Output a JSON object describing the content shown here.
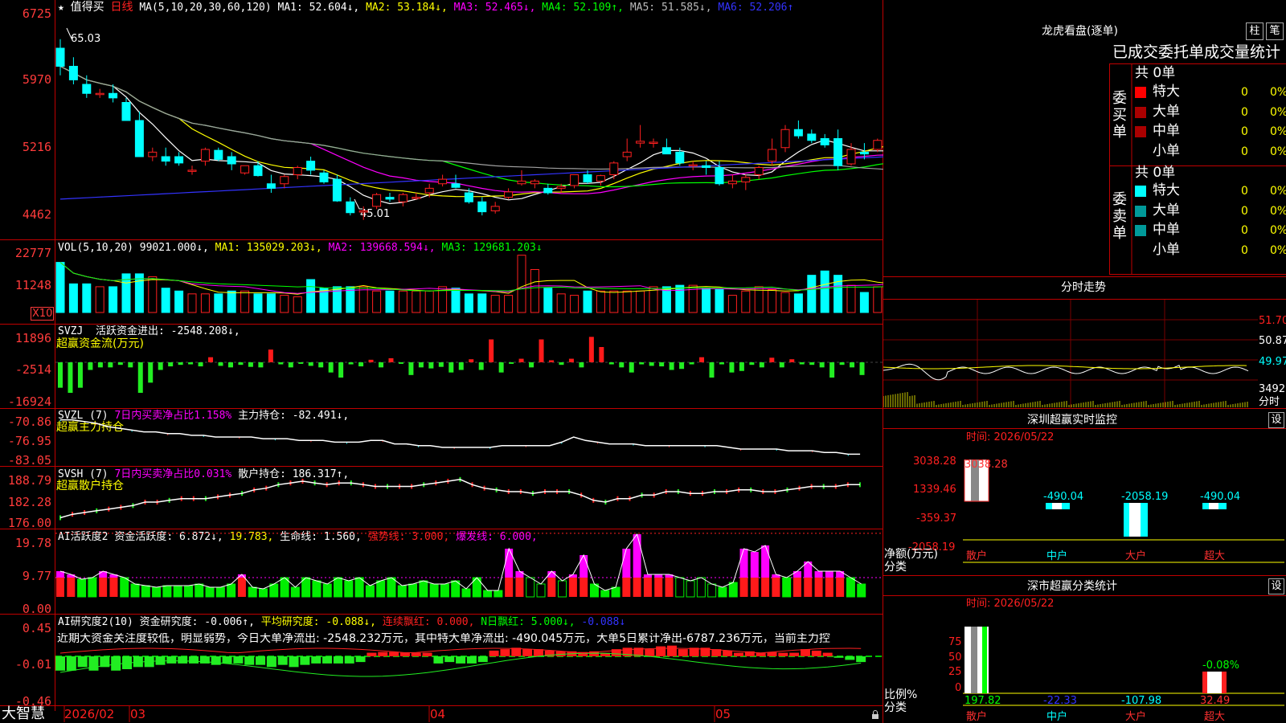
{
  "colors": {
    "up": "#ff2020",
    "down": "#00ffff",
    "ma1": "#ffffff",
    "ma2": "#ffff00",
    "ma3": "#ff00ff",
    "ma4": "#00ff00",
    "ma5": "#a0a0a0",
    "ma6": "#3333ff"
  },
  "kline": {
    "star": "★",
    "stock_name": "值得买",
    "period": "日线",
    "ma_title": "MA(5,10,20,30,60,120)",
    "ma1": "MA1: 52.604↓,",
    "ma2": "MA2: 53.184↓,",
    "ma3": "MA3: 52.465↓,",
    "ma4": "MA4: 52.109↑,",
    "ma5": "MA5: 51.585↓,",
    "ma6": "MA6: 52.206↑",
    "high_mark": "65.03",
    "low_mark": "45.01",
    "y_labels": [
      "6725",
      "5970",
      "5216",
      "4462"
    ]
  },
  "vol": {
    "title": "VOL(5,10,20)",
    "val": "99021.000↓,",
    "ma1": "MA1: 135029.203↓,",
    "ma2": "MA2: 139668.594↓,",
    "ma3": "MA3: 129681.203↓",
    "y_labels": [
      "22777",
      "11248"
    ],
    "unit": "X10"
  },
  "svzj": {
    "title": "SVZJ",
    "desc": "活跃资金进出: -2548.208↓,",
    "sub": "超赢资金流(万元)",
    "y_labels": [
      "11896",
      "-2514",
      "-16924"
    ]
  },
  "svzl": {
    "title": "SVZL (7)",
    "desc": "7日内买卖净占比1.158%",
    "desc2": "主力持仓: -82.491↓,",
    "sub": "超赢主力持仓",
    "y_labels": [
      "-70.86",
      "-76.95",
      "-83.05"
    ]
  },
  "svsh": {
    "title": "SVSH (7)",
    "desc": "7日内买卖净占比0.031%",
    "desc2": "散户持仓: 186.317↑,",
    "sub": "超赢散户持仓",
    "y_labels": [
      "188.79",
      "182.28",
      "176.00"
    ]
  },
  "ai1": {
    "title": "AI活跃度2",
    "l1": "资金活跃度: 6.872↓,",
    "l2": "19.783,",
    "l3": "生命线: 1.560,",
    "l4": "强势线: 3.000,",
    "l5": "爆发线: 6.000,",
    "y_labels": [
      "19.78",
      "9.77",
      "0.00"
    ]
  },
  "ai2": {
    "title": "AI研究度2(10)",
    "l1": "资金研究度: -0.006↑,",
    "l2": "平均研究度: -0.088↓,",
    "l3": "连续飘红: 0.000,",
    "l4": "N日飘红: 5.000↓,",
    "l5": "-0.088↓",
    "comment": "近期大资金关注度较低，明显弱势，今日大单净流出: -2548.232万元，其中特大单净流出: -490.045万元，大单5日累计净出-6787.236万元，当前主力控",
    "y_labels": [
      "0.45",
      "-0.01",
      "-0.46"
    ]
  },
  "xaxis": {
    "brand": "大智慧",
    "labels": [
      "2026/02",
      "03",
      "04",
      "05"
    ]
  },
  "lhb": {
    "title": "龙虎看盘(逐单)",
    "btn1": "柱",
    "btn2": "笔",
    "header": "已成交委托单成交量统计",
    "buy_side": "委买单",
    "sell_side": "委卖单",
    "buy_total": "共 0单",
    "sell_total": "共 0单",
    "rows": [
      "特大",
      "大单",
      "中单",
      "小单"
    ],
    "vals": [
      "0",
      "0",
      "0",
      "0"
    ],
    "pcts": [
      "0%",
      "0%",
      "0%",
      "0%"
    ]
  },
  "fenshi": {
    "title": "分时走势",
    "right_labels": [
      "51.70",
      "50.87",
      "49.97",
      "3492",
      "分时"
    ]
  },
  "shenzhen": {
    "title": "深圳超赢实时监控",
    "btn": "设",
    "time": "时间: 2026/05/22",
    "y_labels": [
      "3038.28",
      "1339.46",
      "-359.37",
      "-2058.19"
    ],
    "axis_label": "净额(万元)",
    "axis_label2": "分类",
    "categories": [
      "散户",
      "中户",
      "大户",
      "超大"
    ],
    "values": [
      "3038.28",
      "-490.04",
      "-2058.19",
      "-490.04"
    ]
  },
  "shishi": {
    "title": "深市超赢分类统计",
    "btn": "设",
    "time": "时间: 2026/05/22",
    "y_labels": [
      "75",
      "50",
      "25",
      "0"
    ],
    "axis_label": "比例%",
    "axis_label2": "分类",
    "categories": [
      "散户",
      "中户",
      "大户",
      "超大"
    ],
    "values": [
      "197.82",
      "-22.33",
      "-107.98",
      "32.49"
    ],
    "annot": "-0.08%"
  },
  "chart_data": [
    {
      "type": "candlestick",
      "title": "值得买 日线",
      "ylim": [
        44,
        68
      ],
      "ohlc": [
        [
          64,
          65,
          61,
          62
        ],
        [
          62,
          63,
          60,
          60.5
        ],
        [
          60,
          61,
          58.5,
          59
        ],
        [
          59,
          59.5,
          58.5,
          59
        ],
        [
          59,
          60,
          58,
          58.5
        ],
        [
          58,
          58.5,
          56,
          56
        ],
        [
          56,
          57,
          52,
          52
        ],
        [
          52,
          53,
          51.5,
          52.5
        ],
        [
          52,
          53,
          51,
          51.5
        ],
        [
          52,
          52.5,
          51,
          51.3
        ],
        [
          50.5,
          51,
          50,
          50.5
        ],
        [
          51.5,
          53,
          51,
          52.8
        ],
        [
          52.7,
          53,
          51.5,
          51.7
        ],
        [
          52,
          52.5,
          50.5,
          51.2
        ],
        [
          50.2,
          51,
          50,
          51
        ],
        [
          51,
          51.5,
          49.8,
          49.9
        ],
        [
          49,
          50,
          48,
          48.5
        ],
        [
          49,
          50,
          48.5,
          49.8
        ],
        [
          50,
          51,
          49.5,
          50.8
        ],
        [
          51.5,
          52,
          50,
          50.5
        ],
        [
          50.2,
          50.5,
          49,
          49.2
        ],
        [
          49.5,
          50,
          47,
          47.1
        ],
        [
          47,
          47.5,
          45.5,
          45.8
        ],
        [
          46,
          46.5,
          45,
          46
        ],
        [
          46.5,
          48,
          46.2,
          47.8
        ],
        [
          47.5,
          48,
          47,
          47.3
        ],
        [
          47,
          48,
          46.5,
          47.8
        ],
        [
          47.5,
          48,
          47.2,
          47.5
        ],
        [
          48,
          49,
          47.5,
          48.5
        ],
        [
          49,
          50,
          48.7,
          49.5
        ],
        [
          49,
          50,
          48.5,
          48.6
        ],
        [
          48,
          48.5,
          46.8,
          47
        ],
        [
          47,
          47.5,
          45.5,
          45.9
        ],
        [
          46,
          47,
          45.7,
          46.5
        ],
        [
          47.5,
          48.5,
          47.3,
          48.1
        ],
        [
          49,
          50.5,
          48.8,
          49.3
        ],
        [
          49,
          49.5,
          48.5,
          49.3
        ],
        [
          48.5,
          49,
          47.8,
          48
        ],
        [
          48.5,
          49,
          48,
          48.7
        ],
        [
          48.8,
          50,
          48.5,
          50
        ],
        [
          50,
          50.5,
          49,
          49.2
        ],
        [
          49.3,
          50,
          48.8,
          49.9
        ],
        [
          50,
          51.5,
          49.5,
          51.3
        ],
        [
          52,
          54,
          51.5,
          52.5
        ],
        [
          53.5,
          55.5,
          53,
          53.7
        ],
        [
          53.5,
          54,
          53,
          53.6
        ],
        [
          53,
          54,
          52.5,
          52.3
        ],
        [
          52.5,
          53,
          51,
          51.3
        ],
        [
          51,
          51.5,
          50.5,
          51.1
        ],
        [
          51,
          51.5,
          50,
          50.8
        ],
        [
          50.8,
          51.5,
          48.8,
          49
        ],
        [
          49,
          50,
          48.5,
          49.3
        ],
        [
          49.2,
          50,
          48.3,
          49.7
        ],
        [
          50,
          51,
          49.5,
          50.8
        ],
        [
          51.5,
          54,
          51,
          52.8
        ],
        [
          53,
          55.5,
          52.5,
          55
        ],
        [
          55,
          56,
          54,
          54.3
        ],
        [
          54.5,
          55,
          53.5,
          53.8
        ],
        [
          54,
          54.5,
          53,
          53.3
        ],
        [
          54,
          55,
          50.5,
          51
        ],
        [
          51.2,
          53.5,
          51,
          52.8
        ],
        [
          52.5,
          53.5,
          51.7,
          52.3
        ],
        [
          52.8,
          54,
          52.5,
          53.8
        ],
        [
          54.5,
          55.5,
          53,
          53.3
        ],
        [
          53.5,
          55,
          52.5,
          52.8
        ],
        [
          53,
          54,
          51.5,
          51.7
        ],
        [
          51.5,
          52,
          50.5,
          50.7
        ]
      ]
    },
    {
      "type": "bar",
      "title": "VOL(5,10,20)",
      "values": [
        17500,
        10000,
        10000,
        9000,
        9000,
        13500,
        13500,
        12500,
        8500,
        7500,
        6500,
        6500,
        6500,
        7500,
        7500,
        6500,
        6500,
        6000,
        5500,
        11500,
        8500,
        9000,
        9000,
        9000,
        7500,
        7500,
        7500,
        7500,
        7500,
        9000,
        8500,
        6500,
        6500,
        6000,
        6000,
        20000,
        15000,
        8500,
        6500,
        6000,
        7500,
        7500,
        7500,
        7500,
        7500,
        9000,
        9000,
        9500,
        9500,
        8500,
        8000,
        6000,
        7500,
        9000,
        8000,
        7000,
        6500,
        13000,
        14500,
        13000,
        9500,
        7000,
        9000,
        12000,
        11000,
        11000,
        13000,
        11500,
        11000,
        8000
      ]
    },
    {
      "type": "bar",
      "title": "SVZJ",
      "values": [
        -5000,
        -6000,
        -5000,
        -1500,
        -1000,
        -1000,
        -500,
        -1000,
        -6000,
        -4000,
        -1500,
        -800,
        -500,
        -400,
        -800,
        1000,
        -700,
        -1000,
        -500,
        -900,
        -1000,
        2500,
        -400,
        -1000,
        -300,
        -700,
        -1000,
        -2000,
        -3000,
        -400,
        -800,
        500,
        -1000,
        800,
        -300,
        -2500,
        -1000,
        -1200,
        -900,
        -2000,
        -1500,
        600,
        -1500,
        4500,
        -2000,
        -300,
        700,
        -1000,
        4500,
        400,
        -500,
        700,
        -1000,
        5000,
        3000,
        -400,
        -1000,
        -2000,
        -400,
        -700,
        -800,
        -1500,
        -1300,
        -400,
        1000,
        -3000,
        -400,
        -2000,
        -1700,
        -500,
        -1000,
        900,
        -1000,
        600,
        -400,
        -500,
        -1000,
        -3000,
        -500,
        -1000,
        -2500
      ]
    },
    {
      "type": "line",
      "title": "SVZL",
      "values": [
        -72,
        -72,
        -72.5,
        -73,
        -74,
        -74.5,
        -75,
        -75.5,
        -75.5,
        -76,
        -76,
        -76.5,
        -76.5,
        -77,
        -77,
        -77,
        -77,
        -77.5,
        -77.5,
        -77.5,
        -78,
        -78,
        -78,
        -78.5,
        -78.5,
        -78.5,
        -78,
        -78,
        -79,
        -79,
        -79.5,
        -79.5,
        -80,
        -80,
        -80,
        -80,
        -80,
        -79.5,
        -79.5,
        -79.5,
        -79.5,
        -79.5,
        -78.5,
        -77,
        -78,
        -78.5,
        -79,
        -79,
        -79,
        -79.5,
        -79.5,
        -79.5,
        -79.5,
        -79.5,
        -79.5,
        -79.5,
        -80,
        -80.5,
        -80.5,
        -80.5,
        -80.5,
        -81,
        -81,
        -81,
        -81.5,
        -81.5,
        -82,
        -82
      ]
    },
    {
      "type": "line",
      "title": "SVSH",
      "values": [
        176.5,
        177.5,
        178,
        178.5,
        179,
        179.5,
        180,
        181,
        181,
        181.5,
        182,
        182,
        182,
        182.5,
        183,
        183.5,
        184.5,
        185,
        186,
        186.5,
        187,
        186.5,
        186,
        186.5,
        186.5,
        186,
        185.5,
        185.5,
        185.5,
        185.5,
        186,
        186.5,
        187,
        187.5,
        186,
        185,
        184.5,
        184,
        184,
        183.5,
        184,
        184,
        184,
        183,
        181.5,
        181,
        182,
        182,
        183,
        183,
        184,
        184,
        183.5,
        183.5,
        184,
        184,
        184.5,
        184.5,
        184,
        184,
        184.5,
        185,
        185.5,
        185.5,
        185.5,
        186,
        186
      ]
    },
    {
      "type": "bar",
      "title": "AI活跃度2",
      "values": [
        8,
        7,
        5.5,
        6,
        8,
        7,
        6,
        4,
        3.5,
        3,
        3.5,
        3.5,
        3.5,
        4,
        3,
        3,
        4,
        7,
        3,
        2.5,
        4,
        6,
        3,
        6,
        5,
        4,
        6,
        5,
        6,
        3.5,
        5,
        6,
        3.5,
        4,
        5,
        4,
        4,
        5,
        2.5,
        6,
        2,
        2,
        15,
        8,
        6,
        4,
        8,
        5,
        7,
        13,
        4,
        2,
        3,
        15,
        19.5,
        7,
        7,
        7,
        6,
        5,
        6,
        4,
        3,
        4.5,
        15,
        14,
        16,
        7,
        6,
        8,
        11,
        8,
        8,
        8,
        6,
        4
      ]
    },
    {
      "type": "bar",
      "title": "AI研究度2(10)",
      "values": [
        -0.2,
        -0.2,
        -0.15,
        -0.2,
        -0.15,
        -0.2,
        -0.18,
        -0.15,
        -0.15,
        -0.12,
        -0.1,
        -0.1,
        -0.1,
        -0.1,
        -0.12,
        -0.1,
        -0.1,
        -0.12,
        -0.12,
        -0.15,
        -0.12,
        -0.15,
        -0.12,
        -0.1,
        -0.1,
        -0.1,
        -0.1,
        -0.08,
        0.05,
        0.06,
        0.06,
        0.05,
        0.05,
        0.05,
        -0.1,
        -0.08,
        -0.1,
        -0.1,
        -0.08,
        0.08,
        0.1,
        0.12,
        0.1,
        0.1,
        0.08,
        0.07,
        0.07,
        0.06,
        0.07,
        0.05,
        0.1,
        0.12,
        0.12,
        0.1,
        0.14,
        0.15,
        0.1,
        0.12,
        0.12,
        0.1,
        0.08,
        0.05,
        0.07,
        0.05,
        0.06,
        0.05,
        0.05,
        0.1,
        0.08,
        0.05,
        -0.02,
        -0.05,
        -0.08
      ]
    }
  ]
}
